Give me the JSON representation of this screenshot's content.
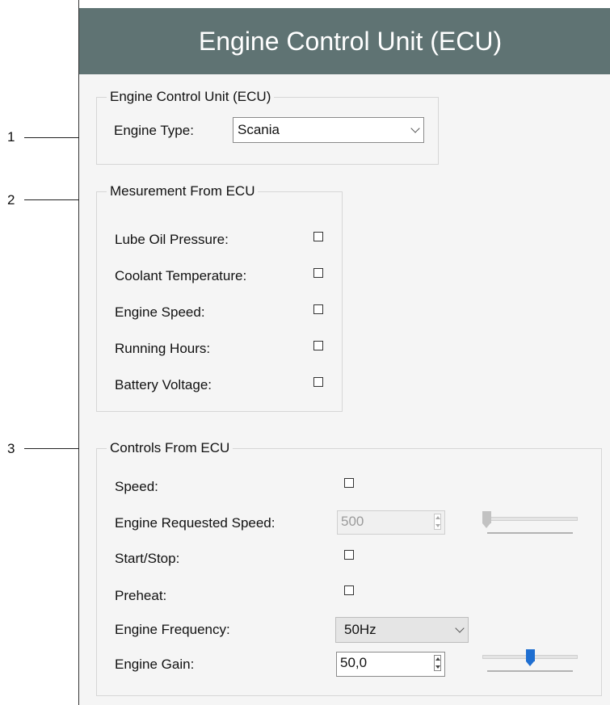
{
  "header": {
    "title": "Engine Control Unit (ECU)"
  },
  "callouts": [
    "1",
    "2",
    "3"
  ],
  "ecu_group": {
    "legend": "Engine Control Unit (ECU)",
    "engine_type_label": "Engine Type:",
    "engine_type_value": "Scania"
  },
  "measurement_group": {
    "legend": "Mesurement From ECU",
    "items": [
      {
        "label": "Lube Oil Pressure:",
        "checked": false
      },
      {
        "label": "Coolant Temperature:",
        "checked": false
      },
      {
        "label": "Engine Speed:",
        "checked": false
      },
      {
        "label": "Running Hours:",
        "checked": false
      },
      {
        "label": "Battery Voltage:",
        "checked": false
      }
    ]
  },
  "controls_group": {
    "legend": "Controls From ECU",
    "speed_label": "Speed:",
    "speed_checked": false,
    "requested_speed_label": "Engine Requested Speed:",
    "requested_speed_value": "500",
    "requested_speed_slider_fraction": 0.0,
    "start_stop_label": "Start/Stop:",
    "start_stop_checked": false,
    "preheat_label": "Preheat:",
    "preheat_checked": false,
    "frequency_label": "Engine Frequency:",
    "frequency_value": "50Hz",
    "gain_label": "Engine Gain:",
    "gain_value": "50,0",
    "gain_slider_fraction": 0.5
  },
  "colors": {
    "header_bg": "#5f7373",
    "slider_accent": "#1f6fd1"
  }
}
